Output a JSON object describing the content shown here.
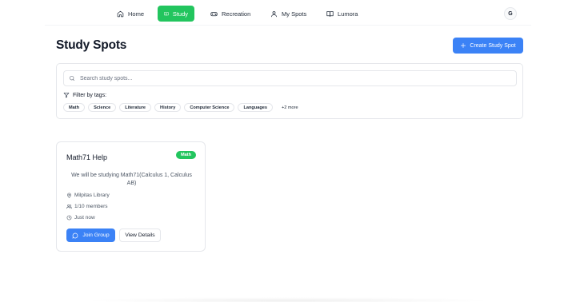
{
  "nav": {
    "items": [
      {
        "label": "Home",
        "icon": "home-icon",
        "active": false
      },
      {
        "label": "Study",
        "icon": "book-open-icon",
        "active": true
      },
      {
        "label": "Recreation",
        "icon": "gamepad-icon",
        "active": false
      },
      {
        "label": "My Spots",
        "icon": "user-icon",
        "active": false
      },
      {
        "label": "Lumora",
        "icon": "book-open-icon",
        "active": false
      }
    ],
    "avatar": "G"
  },
  "header": {
    "title": "Study Spots",
    "create_label": "Create Study Spot"
  },
  "search": {
    "placeholder": "Search study spots...",
    "value": ""
  },
  "filter": {
    "label": "Filter by tags:",
    "tags": [
      "Math",
      "Science",
      "Literature",
      "History",
      "Computer Science",
      "Languages"
    ],
    "more": "+2 more"
  },
  "card": {
    "title": "Math71 Help",
    "badge": "Math",
    "description": "We will be studying Math71(Calculus 1, Calculus AB)",
    "location": "Milpitas Library",
    "members": "1/10 members",
    "time": "Just now",
    "join_label": "Join Group",
    "details_label": "View Details"
  },
  "colors": {
    "accent_green": "#22c55e",
    "accent_blue": "#3b82f6",
    "border": "#e5e7eb"
  }
}
